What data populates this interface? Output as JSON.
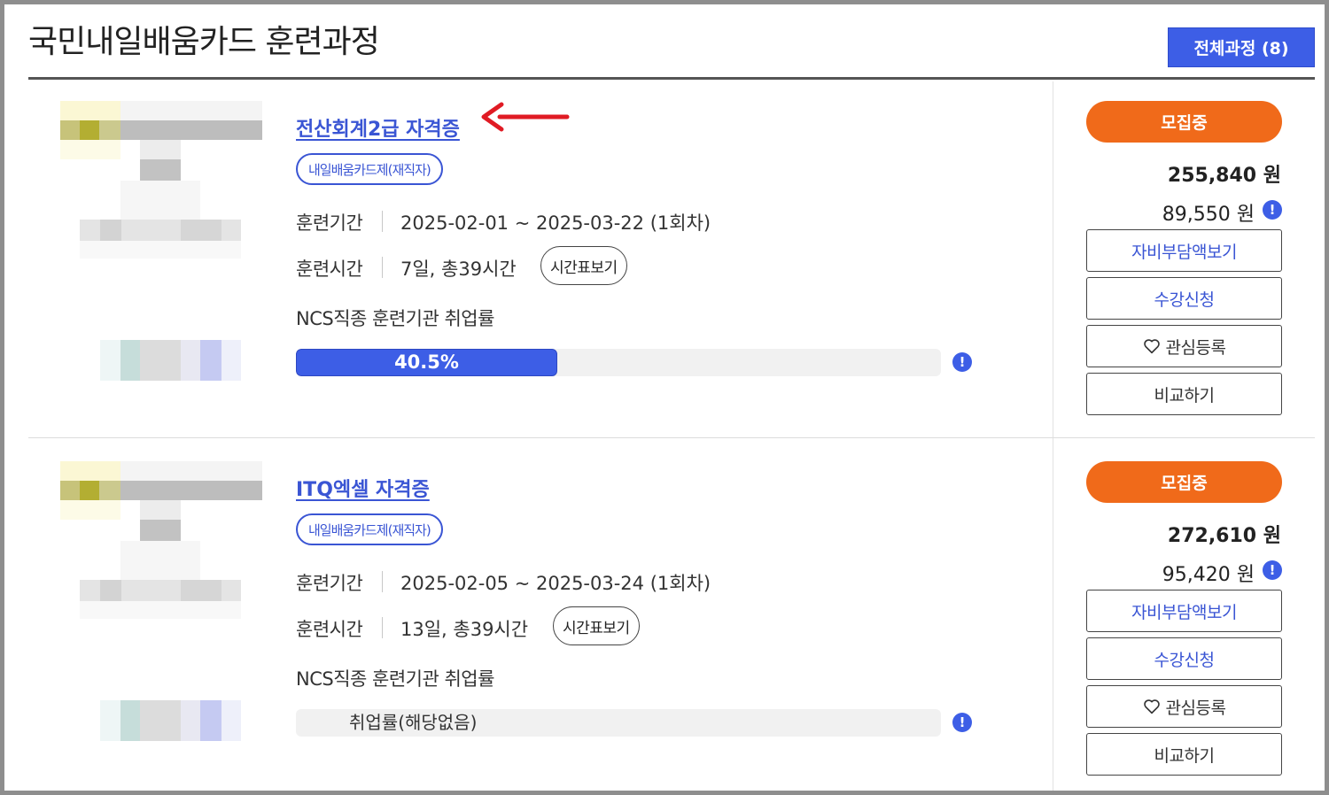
{
  "header": {
    "title": "국민내일배움카드 훈련과정",
    "all_button": "전체과정 (8)"
  },
  "courses": [
    {
      "title": "전산회계2급 자격증",
      "tag": "내일배움카드제(재직자)",
      "period_label": "훈련기간",
      "period": "2025-02-01 ~ 2025-03-22 (1회차)",
      "hours_label": "훈련시간",
      "hours": "7일, 총39시간",
      "schedule_button": "시간표보기",
      "ncs_label": "NCS직종 훈련기관 취업률",
      "employment_rate": "40.5%",
      "employment_rate_value": 40.5,
      "status": "모집중",
      "price": "255,840 원",
      "self_pay": "89,550 원",
      "buttons": {
        "self_pay": "자비부담액보기",
        "apply": "수강신청",
        "favorite": "관심등록",
        "compare": "비교하기"
      }
    },
    {
      "title": "ITQ엑셀 자격증",
      "tag": "내일배움카드제(재직자)",
      "period_label": "훈련기간",
      "period": "2025-02-05 ~ 2025-03-24 (1회차)",
      "hours_label": "훈련시간",
      "hours": "13일, 총39시간",
      "schedule_button": "시간표보기",
      "ncs_label": "NCS직종 훈련기관 취업률",
      "employment_rate": "취업률(해당없음)",
      "status": "모집중",
      "price": "272,610 원",
      "self_pay": "95,420 원",
      "buttons": {
        "self_pay": "자비부담액보기",
        "apply": "수강신청",
        "favorite": "관심등록",
        "compare": "비교하기"
      }
    }
  ],
  "colors": {
    "accent": "#3d5ee6",
    "status": "#f06a1a",
    "annotation_arrow": "#e01b24"
  },
  "icons": {
    "info": "info-icon",
    "heart": "heart-icon",
    "arrow": "red-arrow-annotation"
  }
}
